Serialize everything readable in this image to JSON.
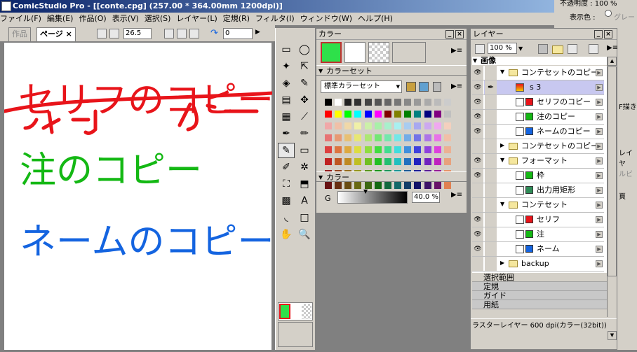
{
  "window": {
    "title": "ComicStudio Pro - [[conte.cpg] (257.00 * 364.00mm 1200dpi)]"
  },
  "menu": [
    "ファイル(F)",
    "編集(E)",
    "作品(O)",
    "表示(V)",
    "選択(S)",
    "レイヤー(L)",
    "定規(R)",
    "フィルタ(I)",
    "ウィンドウ(W)",
    "ヘルプ(H)"
  ],
  "right_fragment": {
    "opacity": "不透明度 : 100 %",
    "display_color_label": "表示色 :",
    "display_color_value": "グレー",
    "side_labels": [
      "F描き",
      "レイヤ",
      "ルビ",
      "頁"
    ]
  },
  "doc_tabs": {
    "tab1": "作品",
    "tab2": "ページ",
    "close": "×",
    "zoom": "26.5",
    "rotate": "0"
  },
  "canvas_text": [
    {
      "text": "セリフのコピー",
      "color": "#e8141a"
    },
    {
      "text": "注のコピー",
      "color": "#14b814"
    },
    {
      "text": "ネームのコピー",
      "color": "#1464e0"
    }
  ],
  "tools": [
    "marquee-tool",
    "lasso-tool",
    "magic-wand-tool",
    "select-tool",
    "layer-move-tool",
    "eyedropper-tool",
    "gradient-tool",
    "move-tool",
    "tone-tool",
    "ruler-tool",
    "pen-tool",
    "pencil-tool",
    "brush-tool",
    "eraser-tool",
    "marker-tool",
    "airbrush-tool",
    "fill-tool",
    "pattern-tool",
    "gradation-tool",
    "text-tool",
    "curve-tool",
    "shape-tool",
    "hand-tool",
    "zoom-tool"
  ],
  "color_panel": {
    "title": "カラー",
    "colorset_header": "カラーセット",
    "colorset_select": "標準カラーセット",
    "color_header": "カラー",
    "g_label": "G",
    "g_value": "40.0 %",
    "main_color": "#2ee04a"
  },
  "layer_panel": {
    "title": "レイヤー",
    "opacity": "100 %",
    "section_header": "画像",
    "layers": [
      {
        "name": "コンテセットのコピー",
        "type": "folder",
        "indent": 1,
        "eye": true,
        "pen": false
      },
      {
        "name": "s 3",
        "type": "raster",
        "indent": 2,
        "eye": true,
        "pen": true,
        "selected": true
      },
      {
        "name": "セリフのコピー",
        "type": "layer",
        "indent": 2,
        "eye": true,
        "color": "#e8141a"
      },
      {
        "name": "注のコピー",
        "type": "layer",
        "indent": 2,
        "eye": true,
        "color": "#14b814"
      },
      {
        "name": "ネームのコピー",
        "type": "layer",
        "indent": 2,
        "eye": true,
        "color": "#1464e0"
      },
      {
        "name": "コンテセットのコピー",
        "type": "folder",
        "indent": 1,
        "eye": false
      },
      {
        "name": "フォーマット",
        "type": "folder",
        "indent": 1,
        "eye": true
      },
      {
        "name": "枠",
        "type": "layer",
        "indent": 2,
        "eye": true,
        "color": "#14b814"
      },
      {
        "name": "出力用矩形",
        "type": "layer",
        "indent": 2,
        "eye": false,
        "color": "#2e8b57"
      },
      {
        "name": "コンテセット",
        "type": "folder",
        "indent": 1,
        "eye": false
      },
      {
        "name": "セリフ",
        "type": "layer",
        "indent": 2,
        "eye": true,
        "color": "#e8141a"
      },
      {
        "name": "注",
        "type": "layer",
        "indent": 2,
        "eye": true,
        "color": "#14b814"
      },
      {
        "name": "ネーム",
        "type": "layer",
        "indent": 2,
        "eye": true,
        "color": "#1464e0"
      },
      {
        "name": "backup",
        "type": "folder",
        "indent": 1,
        "eye": false
      }
    ],
    "bottom_sections": [
      "選択範囲",
      "定規",
      "ガイド",
      "用紙"
    ],
    "status": "ラスターレイヤー 600 dpi(カラー(32bit))"
  }
}
